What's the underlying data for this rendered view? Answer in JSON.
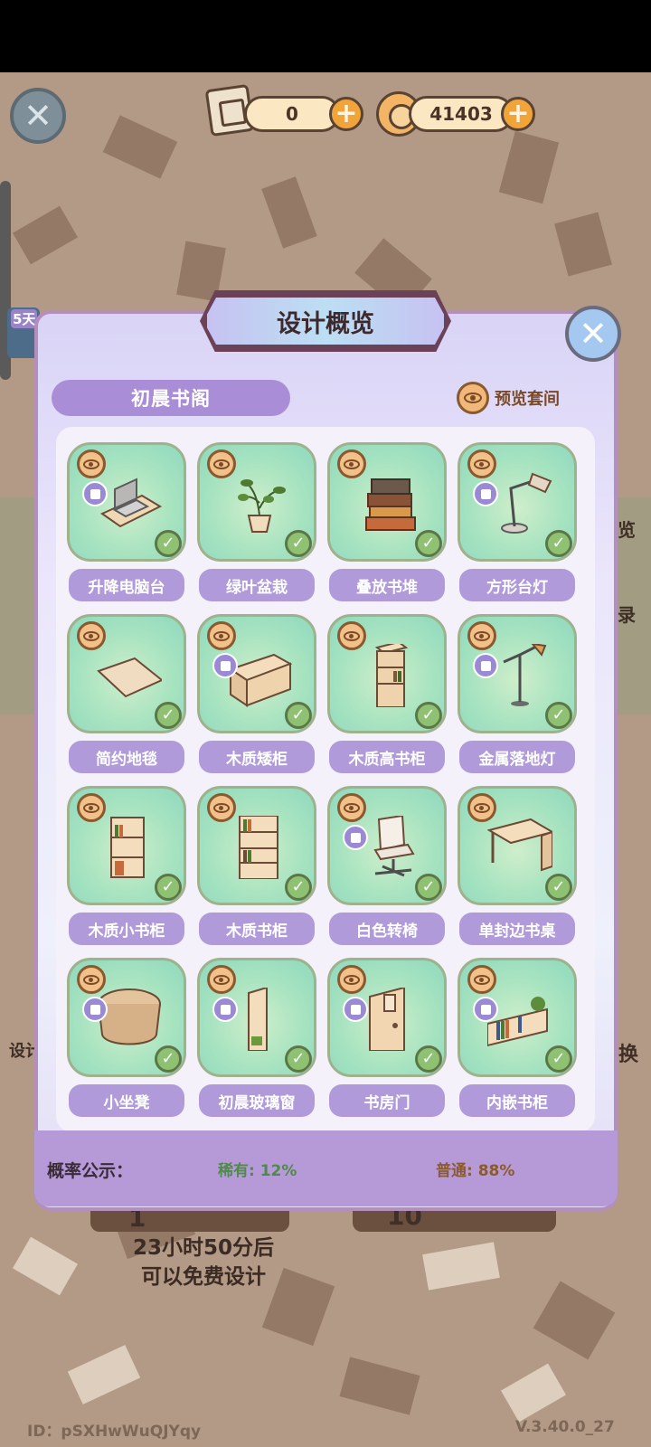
{
  "currency": {
    "tickets": "0",
    "coins": "41403"
  },
  "background": {
    "side_left_badge": "5天",
    "side_right_text_1": "览",
    "side_right_text_2": "录",
    "bottom_left_label": "设计",
    "bottom_right_label": "换",
    "single_count": "1",
    "ten_count": "10",
    "free_line_1": "23小时50分后",
    "free_line_2": "可以免费设计",
    "footer_id": "ID：pSXHwWuQJYqy",
    "footer_version": "V.3.40.0_27"
  },
  "modal": {
    "title": "设计概览",
    "set_name": "初晨书阁",
    "preview_label": "预览套间",
    "probability_label": "概率公示：",
    "rare": "稀有: 12%",
    "common": "普通: 88%"
  },
  "items": [
    {
      "label": "升降电脑台",
      "icon": "laptop-desk-icon",
      "badge": true
    },
    {
      "label": "绿叶盆栽",
      "icon": "plant-icon",
      "badge": false
    },
    {
      "label": "叠放书堆",
      "icon": "book-stack-icon",
      "badge": false
    },
    {
      "label": "方形台灯",
      "icon": "desk-lamp-icon",
      "badge": true
    },
    {
      "label": "简约地毯",
      "icon": "rug-icon",
      "badge": false
    },
    {
      "label": "木质矮柜",
      "icon": "low-cabinet-icon",
      "badge": true
    },
    {
      "label": "木质高书柜",
      "icon": "tall-bookcase-icon",
      "badge": false
    },
    {
      "label": "金属落地灯",
      "icon": "floor-lamp-icon",
      "badge": true
    },
    {
      "label": "木质小书柜",
      "icon": "small-bookcase-icon",
      "badge": false
    },
    {
      "label": "木质书柜",
      "icon": "bookcase-icon",
      "badge": false
    },
    {
      "label": "白色转椅",
      "icon": "swivel-chair-icon",
      "badge": true
    },
    {
      "label": "单封边书桌",
      "icon": "writing-desk-icon",
      "badge": false
    },
    {
      "label": "小坐凳",
      "icon": "stool-icon",
      "badge": true
    },
    {
      "label": "初晨玻璃窗",
      "icon": "window-icon",
      "badge": true
    },
    {
      "label": "书房门",
      "icon": "door-icon",
      "badge": true
    },
    {
      "label": "内嵌书柜",
      "icon": "wall-shelf-icon",
      "badge": true
    }
  ]
}
